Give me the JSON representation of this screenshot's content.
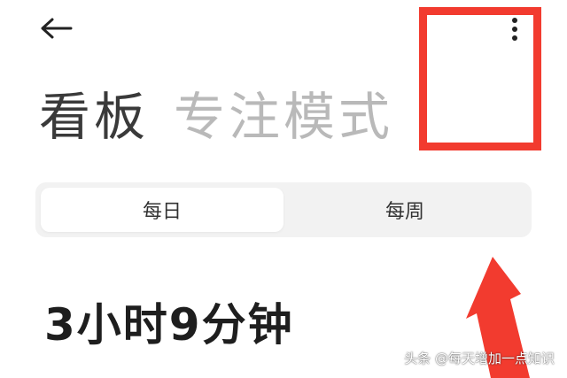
{
  "header": {
    "back_icon": "arrow-left-icon",
    "more_icon": "more-vertical-icon"
  },
  "title_tabs": {
    "active": "看板",
    "inactive": "专注模式"
  },
  "period_selector": {
    "daily": "每日",
    "weekly": "每周",
    "selected": "每日"
  },
  "summary": {
    "total_time": "3小时9分钟"
  },
  "annotation": {
    "color": "#f23b2f"
  },
  "watermark": {
    "text": "头条 @每天增加一点知识"
  }
}
